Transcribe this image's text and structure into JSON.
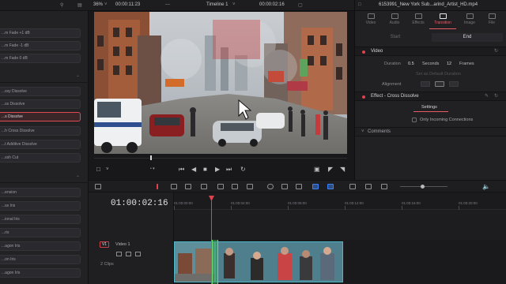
{
  "left_panel": {
    "top_items": [
      "...m Fade +1 dB",
      "...m Fade -1 dB",
      "...m Fade 0 dB"
    ],
    "transition_items": [
      "...ssy Dissolve",
      "...ss Dissolve",
      "...s Dissolve",
      "...h Cross Dissolve",
      "...t Additive Dissolve",
      "...ssh Cut"
    ],
    "selected_index": 2,
    "bottom_items": [
      "...ension",
      "...ss Iris",
      "...ional Iris",
      "...ris",
      "...agon Iris",
      "...on Iris",
      "...agon Iris"
    ]
  },
  "viewer": {
    "zoom": "36%",
    "source_timecode": "00:00:11:23",
    "timeline_name": "Timeline 1",
    "record_timecode": "00:00:02:16"
  },
  "inspector": {
    "file_title": "6153991_New York Sub...arind_Artist_HD.mp4",
    "tabs": [
      "Video",
      "Audio",
      "Effects",
      "Transition",
      "Image",
      "File"
    ],
    "active_tab": "Transition",
    "subtabs": [
      "Start",
      "End"
    ],
    "active_subtab": "End",
    "video_section": "Video",
    "duration_label": "Duration",
    "duration_seconds": "0.5",
    "seconds_label": "Seconds",
    "duration_frames": "12",
    "frames_label": "Frames",
    "set_default": "Set as Default Duration",
    "alignment_label": "Alignment",
    "effect_section": "Effect - Cross Dissolve",
    "settings_tab": "Settings",
    "only_incoming": "Only Incoming Connections",
    "comments_section": "Comments"
  },
  "timeline": {
    "timecode": "01:00:02:16",
    "ruler": [
      "01:00:00:00",
      "01:00:04:00",
      "01:00:08:00",
      "01:00:12:00",
      "01:00:16:00",
      "01:00:20:00"
    ],
    "track_name": "Video 1",
    "track_id": "V1",
    "clip_count": "2 Clips"
  },
  "colors": {
    "accent": "#e0424f",
    "clip_border": "#4fb6c7",
    "transition": "#6fdc7a"
  }
}
